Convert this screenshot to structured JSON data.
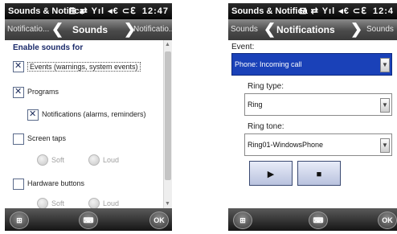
{
  "screen1": {
    "status": {
      "title": "Sounds & Notifica",
      "signal": "⊟ ⇄ Yıl ◂€ ⊂ℇ",
      "time": "12:47"
    },
    "tabs": {
      "prev": "Notificatio...",
      "current": "Sounds",
      "next": "Notificatio..."
    },
    "section_title": "Enable sounds for",
    "options": {
      "events": {
        "label": "Events (warnings, system events)",
        "checked": true
      },
      "programs": {
        "label": "Programs",
        "checked": true
      },
      "notifications": {
        "label": "Notifications (alarms, reminders)",
        "checked": true
      },
      "screen_taps": {
        "label": "Screen taps",
        "checked": false,
        "soft": "Soft",
        "loud": "Loud"
      },
      "hardware_buttons": {
        "label": "Hardware buttons",
        "checked": false,
        "soft": "Soft",
        "loud": "Loud"
      }
    },
    "softkeys": {
      "ok": "OK"
    }
  },
  "screen2": {
    "status": {
      "title": "Sounds & Notifica",
      "signal": "⊟ ⇄ Yıl ◂€ ⊂ℇ",
      "time": "12:4"
    },
    "tabs": {
      "prev": "Sounds",
      "current": "Notifications",
      "next": "Sounds"
    },
    "event_label": "Event:",
    "event_value": "Phone: Incoming call",
    "ring_type_label": "Ring type:",
    "ring_type_value": "Ring",
    "ring_tone_label": "Ring tone:",
    "ring_tone_value": "Ring01-WindowsPhone",
    "play_glyph": "▶",
    "stop_glyph": "■",
    "softkeys": {
      "ok": "OK"
    }
  }
}
